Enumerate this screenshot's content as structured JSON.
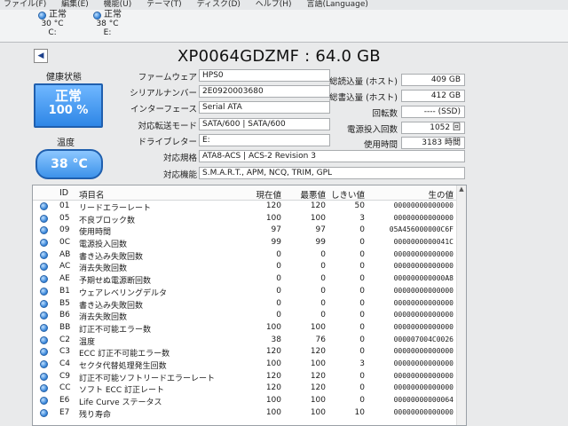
{
  "menu": [
    "ファイル(F)",
    "編集(E)",
    "機能(U)",
    "テーマ(T)",
    "ディスク(D)",
    "ヘルプ(H)",
    "言語(Language)"
  ],
  "drives": [
    {
      "status": "正常",
      "temp": "30 °C",
      "letter": "C:"
    },
    {
      "status": "正常",
      "temp": "38 °C",
      "letter": "E:"
    }
  ],
  "model_title": "XP0064GDZMF : 64.0 GB",
  "health": {
    "label": "健康状態",
    "status": "正常",
    "percent": "100 %"
  },
  "temperature": {
    "label": "温度",
    "value": "38 °C"
  },
  "info": [
    {
      "label": "ファームウェア",
      "value": "HPS0"
    },
    {
      "label": "シリアルナンバー",
      "value": "2E0920003680"
    },
    {
      "label": "インターフェース",
      "value": "Serial ATA"
    },
    {
      "label": "対応転送モード",
      "value": "SATA/600 | SATA/600"
    },
    {
      "label": "ドライブレター",
      "value": "E:"
    },
    {
      "label": "対応規格",
      "value": "ATA8-ACS | ACS-2 Revision 3"
    },
    {
      "label": "対応機能",
      "value": "S.M.A.R.T., APM, NCQ, TRIM, GPL"
    }
  ],
  "stats": [
    {
      "label": "総読込量 (ホスト)",
      "value": "409 GB"
    },
    {
      "label": "総書込量 (ホスト)",
      "value": "412 GB"
    },
    {
      "label": "回転数",
      "value": "---- (SSD)"
    },
    {
      "label": "電源投入回数",
      "value": "1052 回"
    },
    {
      "label": "使用時間",
      "value": "3183 時間"
    }
  ],
  "table_headers": {
    "id": "ID",
    "name": "項目名",
    "current": "現在値",
    "worst": "最悪値",
    "threshold": "しきい値",
    "raw": "生の値"
  },
  "smart": [
    {
      "id": "01",
      "name": "リードエラーレート",
      "cur": "120",
      "wor": "120",
      "thr": "50",
      "raw": "00000000000000"
    },
    {
      "id": "05",
      "name": "不良ブロック数",
      "cur": "100",
      "wor": "100",
      "thr": "3",
      "raw": "00000000000000"
    },
    {
      "id": "09",
      "name": "使用時間",
      "cur": "97",
      "wor": "97",
      "thr": "0",
      "raw": "05A456000000C6F"
    },
    {
      "id": "0C",
      "name": "電源投入回数",
      "cur": "99",
      "wor": "99",
      "thr": "0",
      "raw": "0000000000041C"
    },
    {
      "id": "AB",
      "name": "書き込み失敗回数",
      "cur": "0",
      "wor": "0",
      "thr": "0",
      "raw": "00000000000000"
    },
    {
      "id": "AC",
      "name": "消去失敗回数",
      "cur": "0",
      "wor": "0",
      "thr": "0",
      "raw": "00000000000000"
    },
    {
      "id": "AE",
      "name": "予期せぬ電源断回数",
      "cur": "0",
      "wor": "0",
      "thr": "0",
      "raw": "000000000000A8"
    },
    {
      "id": "B1",
      "name": "ウェアレベリングデルタ",
      "cur": "0",
      "wor": "0",
      "thr": "0",
      "raw": "00000000000000"
    },
    {
      "id": "B5",
      "name": "書き込み失敗回数",
      "cur": "0",
      "wor": "0",
      "thr": "0",
      "raw": "00000000000000"
    },
    {
      "id": "B6",
      "name": "消去失敗回数",
      "cur": "0",
      "wor": "0",
      "thr": "0",
      "raw": "00000000000000"
    },
    {
      "id": "BB",
      "name": "訂正不可能エラー数",
      "cur": "100",
      "wor": "100",
      "thr": "0",
      "raw": "00000000000000"
    },
    {
      "id": "C2",
      "name": "温度",
      "cur": "38",
      "wor": "76",
      "thr": "0",
      "raw": "000007004C0026"
    },
    {
      "id": "C3",
      "name": "ECC 訂正不可能エラー数",
      "cur": "120",
      "wor": "120",
      "thr": "0",
      "raw": "00000000000000"
    },
    {
      "id": "C4",
      "name": "セクタ代替処理発生回数",
      "cur": "100",
      "wor": "100",
      "thr": "3",
      "raw": "00000000000000"
    },
    {
      "id": "C9",
      "name": "訂正不可能ソフトリードエラーレート",
      "cur": "120",
      "wor": "120",
      "thr": "0",
      "raw": "00000000000000"
    },
    {
      "id": "CC",
      "name": "ソフト ECC 訂正レート",
      "cur": "120",
      "wor": "120",
      "thr": "0",
      "raw": "00000000000000"
    },
    {
      "id": "E6",
      "name": "Life Curve ステータス",
      "cur": "100",
      "wor": "100",
      "thr": "0",
      "raw": "00000000000064"
    },
    {
      "id": "E7",
      "name": "残り寿命",
      "cur": "100",
      "wor": "100",
      "thr": "10",
      "raw": "00000000000000"
    }
  ]
}
